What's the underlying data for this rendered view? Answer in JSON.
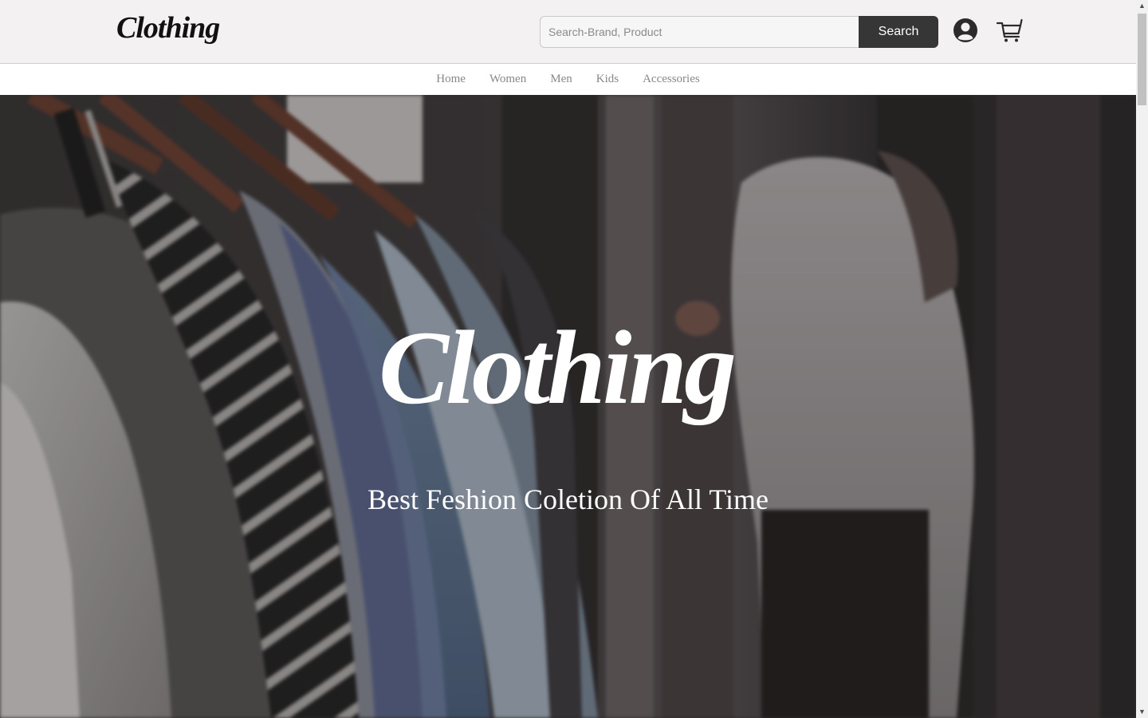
{
  "header": {
    "logo_text": "Clothing",
    "search_placeholder": "Search-Brand, Product",
    "search_value": "",
    "search_button_label": "Search",
    "user_icon": "user-circle-icon",
    "cart_icon": "shopping-cart-icon"
  },
  "nav": {
    "items": [
      {
        "label": "Home"
      },
      {
        "label": "Women"
      },
      {
        "label": "Men"
      },
      {
        "label": "Kids"
      },
      {
        "label": "Accessories"
      }
    ]
  },
  "hero": {
    "title": "Clothing",
    "tagline": "Best Feshion Coletion Of All Time"
  },
  "colors": {
    "header_bg": "#f3f1f2",
    "search_button_bg": "#363636",
    "nav_text": "#888888",
    "hero_text": "#ffffff"
  }
}
